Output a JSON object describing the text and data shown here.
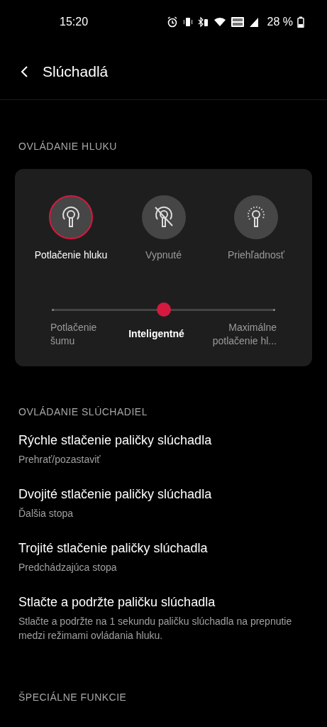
{
  "status_bar": {
    "time": "15:20",
    "battery_text": "28 %"
  },
  "header": {
    "title": "Slúchadlá"
  },
  "noise_section": {
    "title": "OVLÁDANIE HLUKU",
    "modes": [
      {
        "kind": "anc",
        "label": "Potlačenie hluku",
        "selected": true
      },
      {
        "kind": "off",
        "label": "Vypnuté",
        "selected": false
      },
      {
        "kind": "transparency",
        "label": "Priehľadnosť",
        "selected": false
      }
    ],
    "slider": {
      "level": 0.5,
      "stops": [
        {
          "label": "Potlačenie šumu",
          "selected": false
        },
        {
          "label": "Inteligentné",
          "selected": true
        },
        {
          "label": "Maximálne potlačenie hl...",
          "selected": false
        }
      ]
    }
  },
  "controls_section": {
    "title": "OVLÁDANIE SLÚCHADIEL",
    "items": [
      {
        "title": "Rýchle stlačenie paličky slúchadla",
        "subtitle": "Prehrať/pozastaviť"
      },
      {
        "title": "Dvojité stlačenie paličky slúchadla",
        "subtitle": "Ďalšia stopa"
      },
      {
        "title": "Trojité stlačenie paličky slúchadla",
        "subtitle": "Predchádzajúca stopa"
      },
      {
        "title": "Stlačte a podržte paličku slúchadla",
        "subtitle": "Stlačte a podržte na 1 sekundu paličku slúchadla na prepnutie medzi režimami ovládania hluku."
      }
    ]
  },
  "special_section": {
    "title": "ŠPECIÁLNE FUNKCIE"
  }
}
